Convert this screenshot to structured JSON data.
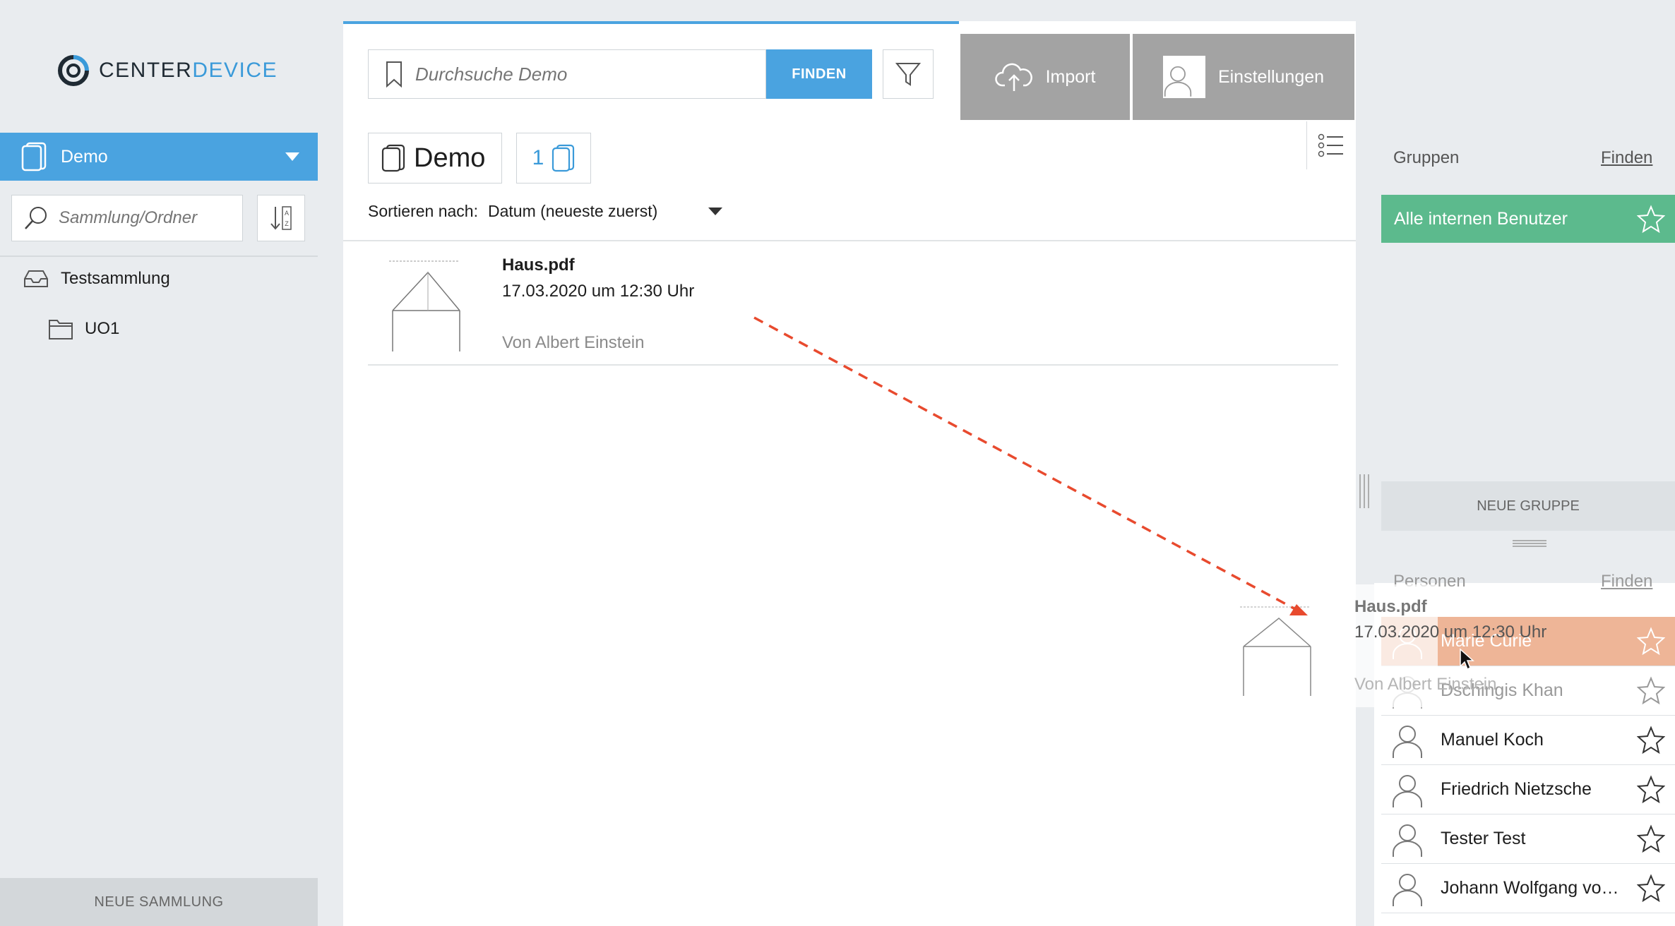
{
  "brand": {
    "logo_main": "CENTER",
    "logo_accent": "DEVICE"
  },
  "sidebar": {
    "collection": "Demo",
    "search_placeholder": "Sammlung/Ordner",
    "tree": [
      {
        "label": "Testsammlung",
        "icon": "inbox-icon"
      },
      {
        "label": "UO1",
        "icon": "folder-icon"
      }
    ],
    "new_collection_label": "NEUE SAMMLUNG"
  },
  "search": {
    "placeholder": "Durchsuche Demo",
    "find_label": "FINDEN"
  },
  "topbar": {
    "import_label": "Import",
    "settings_label": "Einstellungen"
  },
  "main": {
    "breadcrumb": "Demo",
    "doc_count": "1",
    "sort_label": "Sortieren nach:",
    "sort_value": "Datum (neueste zuerst)"
  },
  "documents": [
    {
      "title": "Haus.pdf",
      "date": "17.03.2020 um 12:30 Uhr",
      "author": "Von Albert Einstein"
    }
  ],
  "drag_ghost": {
    "title": "Haus.pdf",
    "date": "17.03.2020 um 12:30 Uhr",
    "author": "Von Albert Einstein"
  },
  "right_panel": {
    "groups_heading": "Gruppen",
    "groups_find": "Finden",
    "groups": [
      {
        "name": "Alle internen Benutzer"
      }
    ],
    "new_group_label": "NEUE GRUPPE",
    "persons_heading": "Personen",
    "persons_find": "Finden",
    "persons": [
      {
        "name": "Marie Curie"
      },
      {
        "name": "Dschingis Khan"
      },
      {
        "name": "Manuel Koch"
      },
      {
        "name": "Friedrich Nietzsche"
      },
      {
        "name": "Tester Test"
      },
      {
        "name": "Johann Wolfgang von ..."
      }
    ]
  },
  "colors": {
    "accent": "#4aa3e0",
    "group_green": "#5cba8d",
    "drop_target_orange": "#eeb597",
    "drag_arrow": "#e84a2e"
  }
}
